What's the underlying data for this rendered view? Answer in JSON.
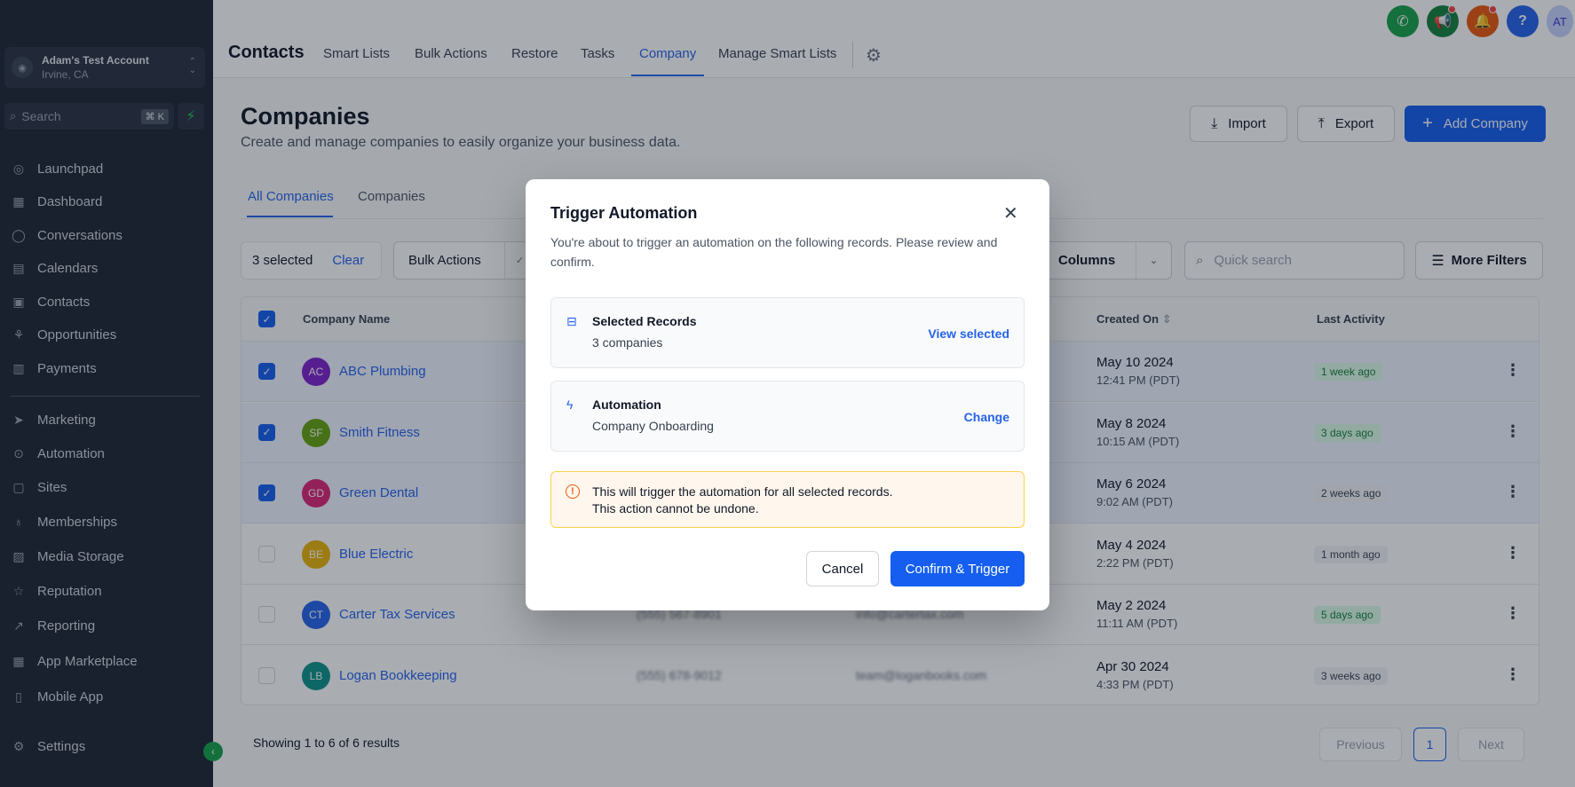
{
  "sidebar": {
    "account": {
      "name": "Adam's Test Account",
      "location": "Irvine, CA"
    },
    "search": {
      "placeholder": "Search",
      "shortcut": "⌘ K"
    },
    "items": [
      {
        "label": "Launchpad",
        "icon": "launchpad-icon"
      },
      {
        "label": "Dashboard",
        "icon": "dashboard-icon"
      },
      {
        "label": "Conversations",
        "icon": "conversations-icon"
      },
      {
        "label": "Calendars",
        "icon": "calendar-icon"
      },
      {
        "label": "Contacts",
        "icon": "contacts-icon"
      },
      {
        "label": "Opportunities",
        "icon": "opportunities-icon"
      },
      {
        "label": "Payments",
        "icon": "payments-icon"
      },
      {
        "label": "Marketing",
        "icon": "marketing-icon"
      },
      {
        "label": "Automation",
        "icon": "automation-icon"
      },
      {
        "label": "Sites",
        "icon": "sites-icon"
      },
      {
        "label": "Memberships",
        "icon": "memberships-icon"
      },
      {
        "label": "Media Storage",
        "icon": "media-storage-icon"
      },
      {
        "label": "Reputation",
        "icon": "reputation-icon"
      },
      {
        "label": "Reporting",
        "icon": "reporting-icon"
      },
      {
        "label": "App Marketplace",
        "icon": "app-marketplace-icon"
      },
      {
        "label": "Mobile App",
        "icon": "mobile-app-icon"
      }
    ],
    "settings_label": "Settings"
  },
  "topbar": {
    "title": "Contacts",
    "tabs": [
      {
        "label": "Smart Lists"
      },
      {
        "label": "Bulk Actions"
      },
      {
        "label": "Restore"
      },
      {
        "label": "Tasks"
      },
      {
        "label": "Company"
      },
      {
        "label": "Manage Smart Lists"
      }
    ],
    "active_tab": "Company",
    "user_initials": "AT"
  },
  "page": {
    "title": "Companies",
    "subtitle": "Create and manage companies to easily organize your business data.",
    "import_label": "Import",
    "export_label": "Export",
    "add_label": "Add Company",
    "subtabs": [
      {
        "label": "All Companies"
      },
      {
        "label": "Companies"
      }
    ],
    "selected_text": "3 selected",
    "clear_label": "Clear",
    "bulk_label": "Bulk Actions",
    "columns_label": "Columns",
    "quick_search_placeholder": "Quick search",
    "more_filters_label": "More Filters"
  },
  "table": {
    "headers": {
      "name": "Company Name",
      "created": "Created On",
      "activity": "Last Activity"
    },
    "rows": [
      {
        "initials": "AC",
        "color": "#7e22ce",
        "name": "ABC Plumbing",
        "phone": "",
        "email": "",
        "date": "May 10 2024",
        "time": "12:41 PM (PDT)",
        "activity": "1 week ago",
        "badge": "green",
        "checked": true
      },
      {
        "initials": "SF",
        "color": "#65a30d",
        "name": "Smith Fitness",
        "phone": "",
        "email": "",
        "date": "May 8 2024",
        "time": "10:15 AM (PDT)",
        "activity": "3 days ago",
        "badge": "green",
        "checked": true
      },
      {
        "initials": "GD",
        "color": "#db2777",
        "name": "Green Dental",
        "phone": "",
        "email": "",
        "date": "May 6 2024",
        "time": "9:02 AM (PDT)",
        "activity": "2 weeks ago",
        "badge": "gray",
        "checked": true
      },
      {
        "initials": "BE",
        "color": "#eab308",
        "name": "Blue Electric",
        "phone": "",
        "email": "",
        "date": "May 4 2024",
        "time": "2:22 PM (PDT)",
        "activity": "1 month ago",
        "badge": "gray",
        "checked": false
      },
      {
        "initials": "CT",
        "color": "#2563eb",
        "name": "Carter Tax Services",
        "phone": "(555) 567-8901",
        "email": "info@cartertax.com",
        "date": "May 2 2024",
        "time": "11:11 AM (PDT)",
        "activity": "5 days ago",
        "badge": "green",
        "checked": false
      },
      {
        "initials": "LB",
        "color": "#0d9488",
        "name": "Logan Bookkeeping",
        "phone": "(555) 678-9012",
        "email": "team@loganbooks.com",
        "date": "Apr 30 2024",
        "time": "4:33 PM (PDT)",
        "activity": "3 weeks ago",
        "badge": "gray",
        "checked": false
      }
    ]
  },
  "pagination": {
    "summary": "Showing 1 to 6 of 6 results",
    "prev": "Previous",
    "current": "1",
    "next": "Next"
  },
  "modal": {
    "title": "Trigger Automation",
    "description": "You're about to trigger an automation on the following records. Please review and confirm.",
    "records_title": "Selected Records",
    "records_value": "3 companies",
    "records_action": "View selected",
    "automation_title": "Automation",
    "automation_value": "Company Onboarding",
    "automation_action": "Change",
    "warning_line1": "This will trigger the automation for all selected records.",
    "warning_line2": "This action cannot be undone.",
    "cancel_label": "Cancel",
    "confirm_label": "Confirm & Trigger"
  },
  "colors": {
    "accent": "#155eef",
    "sidebar_bg": "#1e2533",
    "warning_bg": "#fff7ed"
  }
}
